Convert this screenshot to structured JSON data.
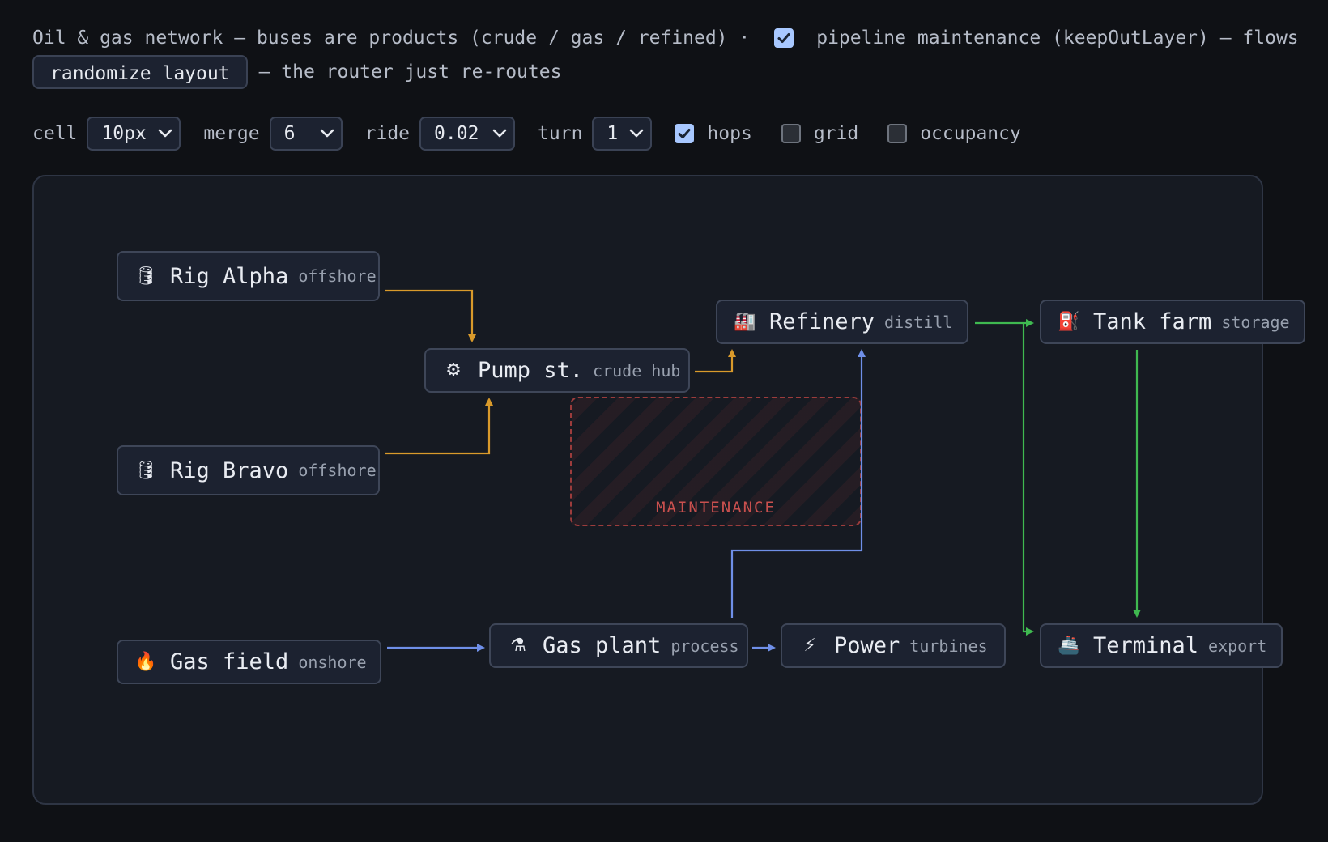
{
  "header": {
    "description": "Oil & gas network — buses are products (crude / gas / refined) ·",
    "maintenance_label": "pipeline maintenance (keepOutLayer) — flows",
    "randomize_button": "randomize layout",
    "reroute_note": "— the router just re-routes"
  },
  "controls": {
    "cell": {
      "label": "cell",
      "value": "10px"
    },
    "merge": {
      "label": "merge",
      "value": "6"
    },
    "ride": {
      "label": "ride",
      "value": "0.02"
    },
    "turn": {
      "label": "turn",
      "value": "1"
    },
    "hops": {
      "label": "hops",
      "checked": true
    },
    "grid": {
      "label": "grid",
      "checked": false
    },
    "occupancy": {
      "label": "occupancy",
      "checked": false
    }
  },
  "maintenance_checked": true,
  "maintenance_zone": {
    "label": "MAINTENANCE"
  },
  "nodes": {
    "rig_alpha": {
      "icon": "barrel-icon",
      "glyph": "🛢",
      "name": "Rig Alpha",
      "sub": "offshore"
    },
    "rig_bravo": {
      "icon": "barrel-icon",
      "glyph": "🛢",
      "name": "Rig Bravo",
      "sub": "offshore"
    },
    "gas_field": {
      "icon": "flame-icon",
      "glyph": "🔥",
      "name": "Gas field",
      "sub": "onshore"
    },
    "pump": {
      "icon": "gear-icon",
      "glyph": "⚙",
      "name": "Pump st.",
      "sub": "crude hub"
    },
    "refinery": {
      "icon": "factory-icon",
      "glyph": "🏭",
      "name": "Refinery",
      "sub": "distill"
    },
    "tank_farm": {
      "icon": "fuel-pump-icon",
      "glyph": "⛽",
      "name": "Tank farm",
      "sub": "storage"
    },
    "gas_plant": {
      "icon": "flask-icon",
      "glyph": "⚗",
      "name": "Gas plant",
      "sub": "process"
    },
    "power": {
      "icon": "lightning-icon",
      "glyph": "⚡",
      "name": "Power",
      "sub": "turbines"
    },
    "terminal": {
      "icon": "ship-icon",
      "glyph": "🚢",
      "name": "Terminal",
      "sub": "export"
    }
  },
  "colors": {
    "crude": "#d99a2b",
    "gas": "#6f8fe8",
    "refined": "#3fb950",
    "background": "#0f1115",
    "panel": "#161a22",
    "maintenance": "#c9504e"
  }
}
